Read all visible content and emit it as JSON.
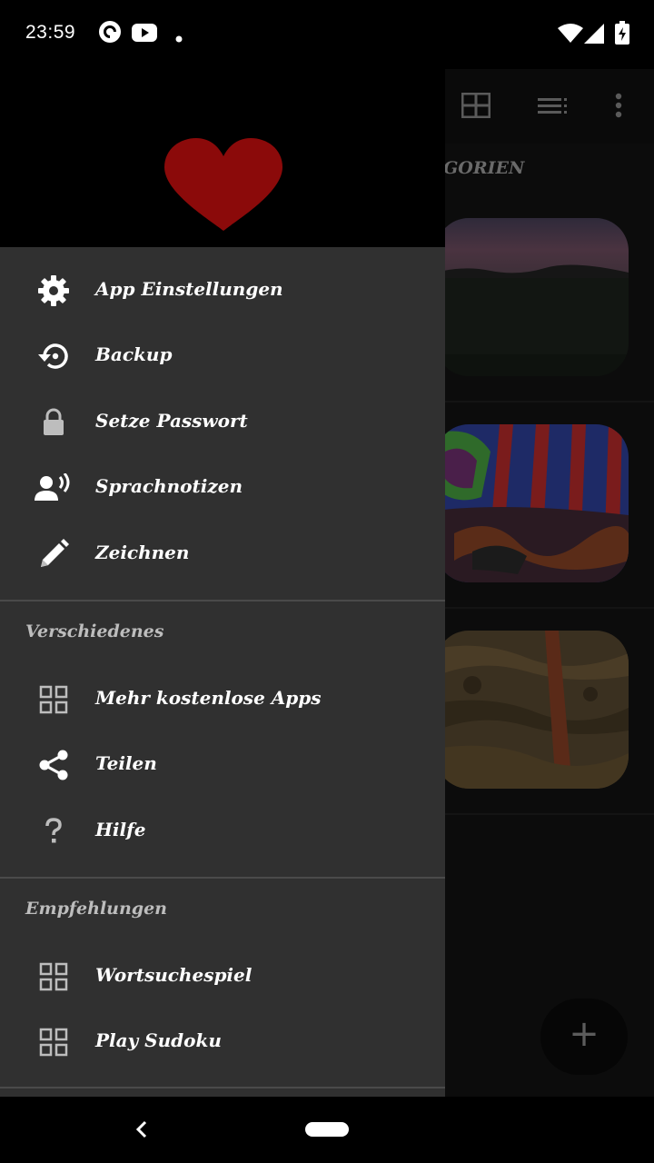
{
  "status_bar": {
    "time": "23:59",
    "icons": [
      "pocketcasts-icon",
      "youtube-icon",
      "dot-icon",
      "wifi-icon",
      "signal-icon",
      "battery-icon"
    ]
  },
  "background": {
    "toolbar_icons": [
      "grid-view-icon",
      "list-view-icon",
      "more-vert-icon"
    ],
    "section_title": "KATEGORIEN",
    "thumbnails": [
      "sunset-field",
      "graffiti",
      "tree-bark"
    ],
    "fab_icon": "add-icon"
  },
  "drawer": {
    "header_icon": "heart-icon",
    "header_color": "#8b0a0a",
    "main_items": [
      {
        "label": "App Einstellungen",
        "icon": "settings-icon"
      },
      {
        "label": "Backup",
        "icon": "backup-restore-icon"
      },
      {
        "label": "Setze Passwort",
        "icon": "lock-icon"
      },
      {
        "label": "Sprachnotizen",
        "icon": "voice-person-icon"
      },
      {
        "label": "Zeichnen",
        "icon": "pencil-icon"
      }
    ],
    "misc_header": "Verschiedenes",
    "misc_items": [
      {
        "label": "Mehr kostenlose Apps",
        "icon": "apps-grid-icon"
      },
      {
        "label": "Teilen",
        "icon": "share-icon"
      },
      {
        "label": "Hilfe",
        "icon": "help-icon"
      }
    ],
    "rec_header": "Empfehlungen",
    "rec_items": [
      {
        "label": "Wortsuchespiel",
        "icon": "apps-grid-icon"
      },
      {
        "label": "Play Sudoku",
        "icon": "apps-grid-icon"
      }
    ]
  },
  "nav_bar": {
    "back_icon": "back-icon",
    "home_icon": "home-pill-icon"
  }
}
